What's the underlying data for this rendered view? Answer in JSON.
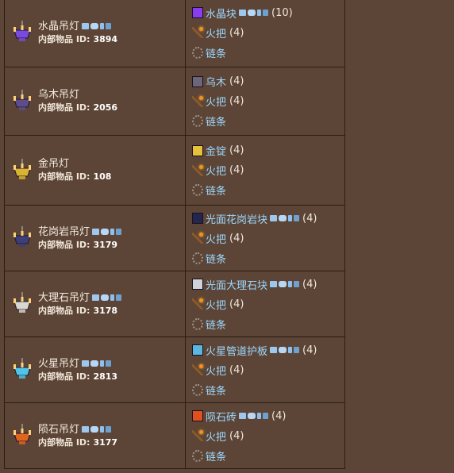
{
  "rows": [
    {
      "result": {
        "name": "水晶吊灯",
        "id_label": "内部物品 ID:",
        "id": "3894",
        "icon": "crystal-chandelier-icon",
        "icon_color": "#7a4ae0",
        "badges": true
      },
      "ingredients": [
        {
          "name": "水晶块",
          "qty": "(10)",
          "icon": "crystal-block-icon",
          "icon_color": "#8a3cf0",
          "badges": true
        },
        {
          "name": "火把",
          "qty": "(4)",
          "icon": "torch-icon",
          "badges": false
        },
        {
          "name": "链条",
          "qty": "",
          "icon": "chain-icon",
          "badges": false
        }
      ]
    },
    {
      "result": {
        "name": "乌木吊灯",
        "id_label": "内部物品 ID:",
        "id": "2056",
        "icon": "ebonwood-chandelier-icon",
        "icon_color": "#5d4d8a",
        "badges": false
      },
      "ingredients": [
        {
          "name": "乌木",
          "qty": "(4)",
          "icon": "ebonwood-icon",
          "icon_color": "#6b6678",
          "badges": false
        },
        {
          "name": "火把",
          "qty": "(4)",
          "icon": "torch-icon",
          "badges": false
        },
        {
          "name": "链条",
          "qty": "",
          "icon": "chain-icon",
          "badges": false
        }
      ]
    },
    {
      "result": {
        "name": "金吊灯",
        "id_label": "内部物品 ID:",
        "id": "108",
        "icon": "gold-chandelier-icon",
        "icon_color": "#d9b430",
        "badges": false
      },
      "ingredients": [
        {
          "name": "金锭",
          "qty": "(4)",
          "icon": "gold-bar-icon",
          "icon_color": "#e6c23a",
          "badges": false
        },
        {
          "name": "火把",
          "qty": "(4)",
          "icon": "torch-icon",
          "badges": false
        },
        {
          "name": "链条",
          "qty": "",
          "icon": "chain-icon",
          "badges": false
        }
      ]
    },
    {
      "result": {
        "name": "花岗岩吊灯",
        "id_label": "内部物品 ID:",
        "id": "3179",
        "icon": "granite-chandelier-icon",
        "icon_color": "#3c3f78",
        "badges": true
      },
      "ingredients": [
        {
          "name": "光面花岗岩块",
          "qty": "(4)",
          "icon": "smooth-granite-icon",
          "icon_color": "#24274d",
          "badges": true
        },
        {
          "name": "火把",
          "qty": "(4)",
          "icon": "torch-icon",
          "badges": false
        },
        {
          "name": "链条",
          "qty": "",
          "icon": "chain-icon",
          "badges": false
        }
      ]
    },
    {
      "result": {
        "name": "大理石吊灯",
        "id_label": "内部物品 ID:",
        "id": "3178",
        "icon": "marble-chandelier-icon",
        "icon_color": "#d8d8d0",
        "badges": true
      },
      "ingredients": [
        {
          "name": "光面大理石块",
          "qty": "(4)",
          "icon": "smooth-marble-icon",
          "icon_color": "#cfd2d6",
          "badges": true
        },
        {
          "name": "火把",
          "qty": "(4)",
          "icon": "torch-icon",
          "badges": false
        },
        {
          "name": "链条",
          "qty": "",
          "icon": "chain-icon",
          "badges": false
        }
      ]
    },
    {
      "result": {
        "name": "火星吊灯",
        "id_label": "内部物品 ID:",
        "id": "2813",
        "icon": "martian-chandelier-icon",
        "icon_color": "#4fc6e8",
        "badges": true
      },
      "ingredients": [
        {
          "name": "火星管道护板",
          "qty": "(4)",
          "icon": "martian-conduit-plating-icon",
          "icon_color": "#5ab8e0",
          "badges": true
        },
        {
          "name": "火把",
          "qty": "(4)",
          "icon": "torch-icon",
          "badges": false
        },
        {
          "name": "链条",
          "qty": "",
          "icon": "chain-icon",
          "badges": false
        }
      ]
    },
    {
      "result": {
        "name": "陨石吊灯",
        "id_label": "内部物品 ID:",
        "id": "3177",
        "icon": "meteorite-chandelier-icon",
        "icon_color": "#e0641e",
        "badges": true
      },
      "ingredients": [
        {
          "name": "陨石砖",
          "qty": "(4)",
          "icon": "meteorite-brick-icon",
          "icon_color": "#e0501e",
          "badges": true
        },
        {
          "name": "火把",
          "qty": "(4)",
          "icon": "torch-icon",
          "badges": false
        },
        {
          "name": "链条",
          "qty": "",
          "icon": "chain-icon",
          "badges": false
        }
      ]
    }
  ]
}
